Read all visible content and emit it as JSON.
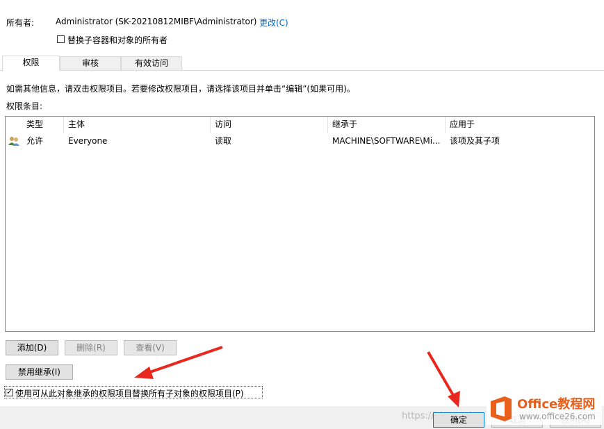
{
  "owner": {
    "label": "所有者:",
    "value": "Administrator (SK-20210812MIBF\\Administrator)",
    "change_link": "更改(C)",
    "replace_checkbox_label": "替换子容器和对象的所有者",
    "replace_checked": false
  },
  "tabs": [
    {
      "label": "权限",
      "active": true
    },
    {
      "label": "审核",
      "active": false
    },
    {
      "label": "有效访问",
      "active": false
    }
  ],
  "info_text": "如需其他信息，请双击权限项目。若要修改权限项目，请选择该项目并单击“编辑”(如果可用)。",
  "entries_label": "权限条目:",
  "table": {
    "columns": [
      "类型",
      "主体",
      "访问",
      "继承于",
      "应用于"
    ],
    "rows": [
      {
        "icon": "users-icon",
        "type": "允许",
        "principal": "Everyone",
        "access": "读取",
        "inherited_from": "MACHINE\\SOFTWARE\\Mi...",
        "applies_to": "该项及其子项"
      }
    ]
  },
  "buttons": {
    "add": "添加(D)",
    "remove": "删除(R)",
    "view": "查看(V)",
    "disable_inheritance": "禁用继承(I)",
    "ok": "确定",
    "cancel": "取消",
    "apply": "应用(A)"
  },
  "replace_child_checkbox": {
    "label": "使用可从此对象继承的权限项目替换所有子对象的权限项目(P)",
    "checked": true
  },
  "watermark": "https://blog.csdn",
  "logo": {
    "brand": "Office教程网",
    "url": "www.office26.com"
  },
  "colors": {
    "link": "#0066cc",
    "arrow": "#e8281e",
    "logo_orange": "#e8601c"
  }
}
